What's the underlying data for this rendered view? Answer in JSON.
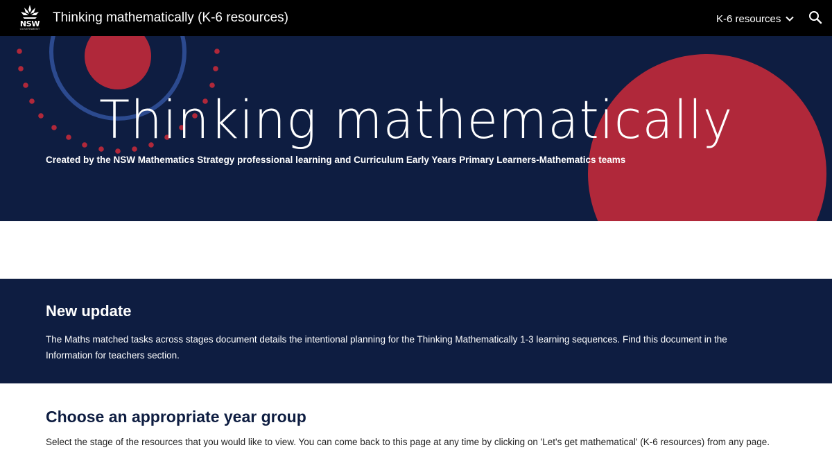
{
  "header": {
    "logo": {
      "text": "NSW",
      "subtext": "GOVERNMENT",
      "icon": "waratah-icon"
    },
    "site_title": "Thinking mathematically (K-6 resources)",
    "nav_dropdown_label": "K-6 resources",
    "nav_dropdown_icon": "chevron-down-icon",
    "search_icon": "search-icon"
  },
  "hero": {
    "title": "Thinking mathematically",
    "subtitle": "Created by the NSW Mathematics Strategy professional learning and Curriculum Early Years Primary Learners-Mathematics teams"
  },
  "update": {
    "heading": "New update",
    "body": "The Maths matched tasks across stages document details the intentional planning for the Thinking Mathematically 1-3 learning sequences. Find this document in the Information for teachers section."
  },
  "choose": {
    "heading": "Choose an appropriate year group",
    "body": "Select the stage of the resources that you would like to view. You can come back to this page at any time by clicking on 'Let's get mathematical' (K-6 resources) from any page."
  },
  "colors": {
    "navy": "#0e1d41",
    "red": "#b0283a",
    "blue_ring": "#2c4a8f",
    "topbar": "#000000"
  }
}
